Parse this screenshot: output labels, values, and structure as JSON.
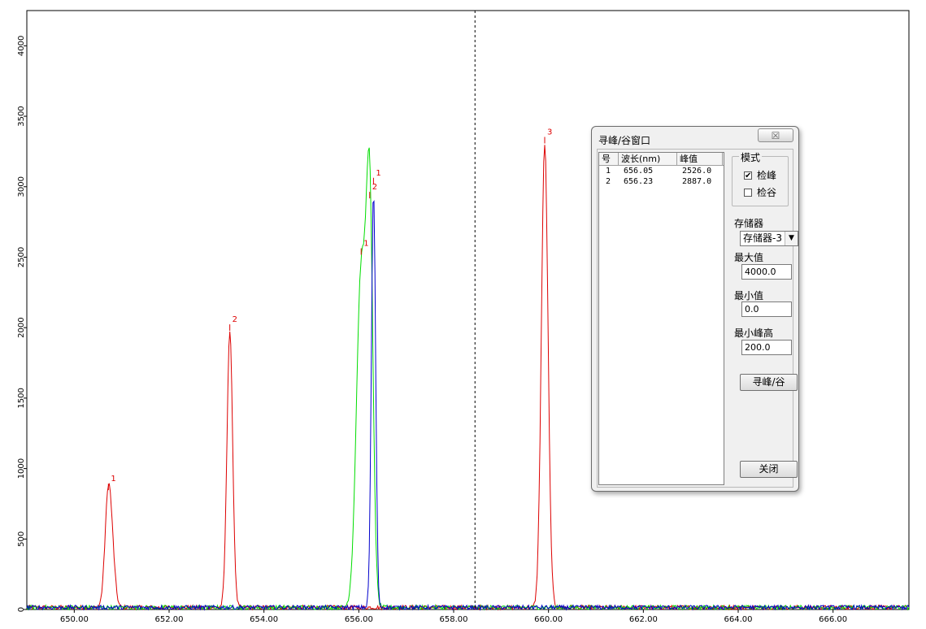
{
  "chart_data": {
    "type": "line",
    "xlim": [
      649.0,
      667.6
    ],
    "ylim": [
      0,
      4250
    ],
    "x_ticks": [
      "650.00",
      "652.00",
      "654.00",
      "656.00",
      "658.00",
      "660.00",
      "662.00",
      "664.00",
      "666.00"
    ],
    "x_tick_values": [
      650,
      652,
      654,
      656,
      658,
      660,
      662,
      664,
      666
    ],
    "y_ticks": [
      "0",
      "500",
      "1000",
      "1500",
      "2000",
      "2500",
      "3000",
      "3500",
      "4000"
    ],
    "y_tick_values": [
      0,
      500,
      1000,
      1500,
      2000,
      2500,
      3000,
      3500,
      4000
    ],
    "cursor_x": 658.45,
    "noise_level": 30,
    "series": [
      {
        "color": "#dd0000",
        "peaks": [
          {
            "x": 650.72,
            "height": 830,
            "width": 0.07
          },
          {
            "x": 650.82,
            "height": 180,
            "width": 0.06
          },
          {
            "x": 653.28,
            "height": 1960,
            "width": 0.06
          },
          {
            "x": 659.92,
            "height": 3290,
            "width": 0.07
          }
        ]
      },
      {
        "color": "#00dd00",
        "peaks": [
          {
            "x": 656.05,
            "height": 2380,
            "width": 0.1
          },
          {
            "x": 656.23,
            "height": 2720,
            "width": 0.07
          }
        ]
      },
      {
        "color": "#0000cc",
        "peaks": [
          {
            "x": 656.31,
            "height": 2950,
            "width": 0.045
          }
        ]
      }
    ],
    "peak_labels": [
      {
        "x": 650.72,
        "y": 830,
        "text": "1",
        "color": "#dd0000"
      },
      {
        "x": 653.28,
        "y": 1960,
        "text": "2",
        "color": "#dd0000"
      },
      {
        "x": 659.92,
        "y": 3290,
        "text": "3",
        "color": "#dd0000"
      },
      {
        "x": 656.05,
        "y": 2500,
        "text": "1",
        "color": "#dd0000"
      },
      {
        "x": 656.23,
        "y": 2900,
        "text": "2",
        "color": "#dd0000"
      },
      {
        "x": 656.31,
        "y": 3000,
        "text": "1",
        "color": "#dd0000"
      }
    ]
  },
  "dialog": {
    "title": "寻峰/谷窗口",
    "close_glyph": "☒",
    "table": {
      "headers": [
        "号",
        "波长(nm)",
        "峰值"
      ],
      "rows": [
        [
          "1",
          "656.05",
          "2526.0"
        ],
        [
          "2",
          "656.23",
          "2887.0"
        ]
      ]
    },
    "mode": {
      "title": "模式",
      "peak_label": "检峰",
      "valley_label": "检谷",
      "peak_mark": "✔",
      "valley_mark": ""
    },
    "storage": {
      "label": "存储器",
      "value": "存储器-3",
      "arrow": "▼"
    },
    "max": {
      "label": "最大值",
      "value": "4000.0"
    },
    "min": {
      "label": "最小值",
      "value": "0.0"
    },
    "min_peak": {
      "label": "最小峰高",
      "value": "200.0"
    },
    "find_button": "寻峰/谷",
    "close_button": "关闭"
  }
}
